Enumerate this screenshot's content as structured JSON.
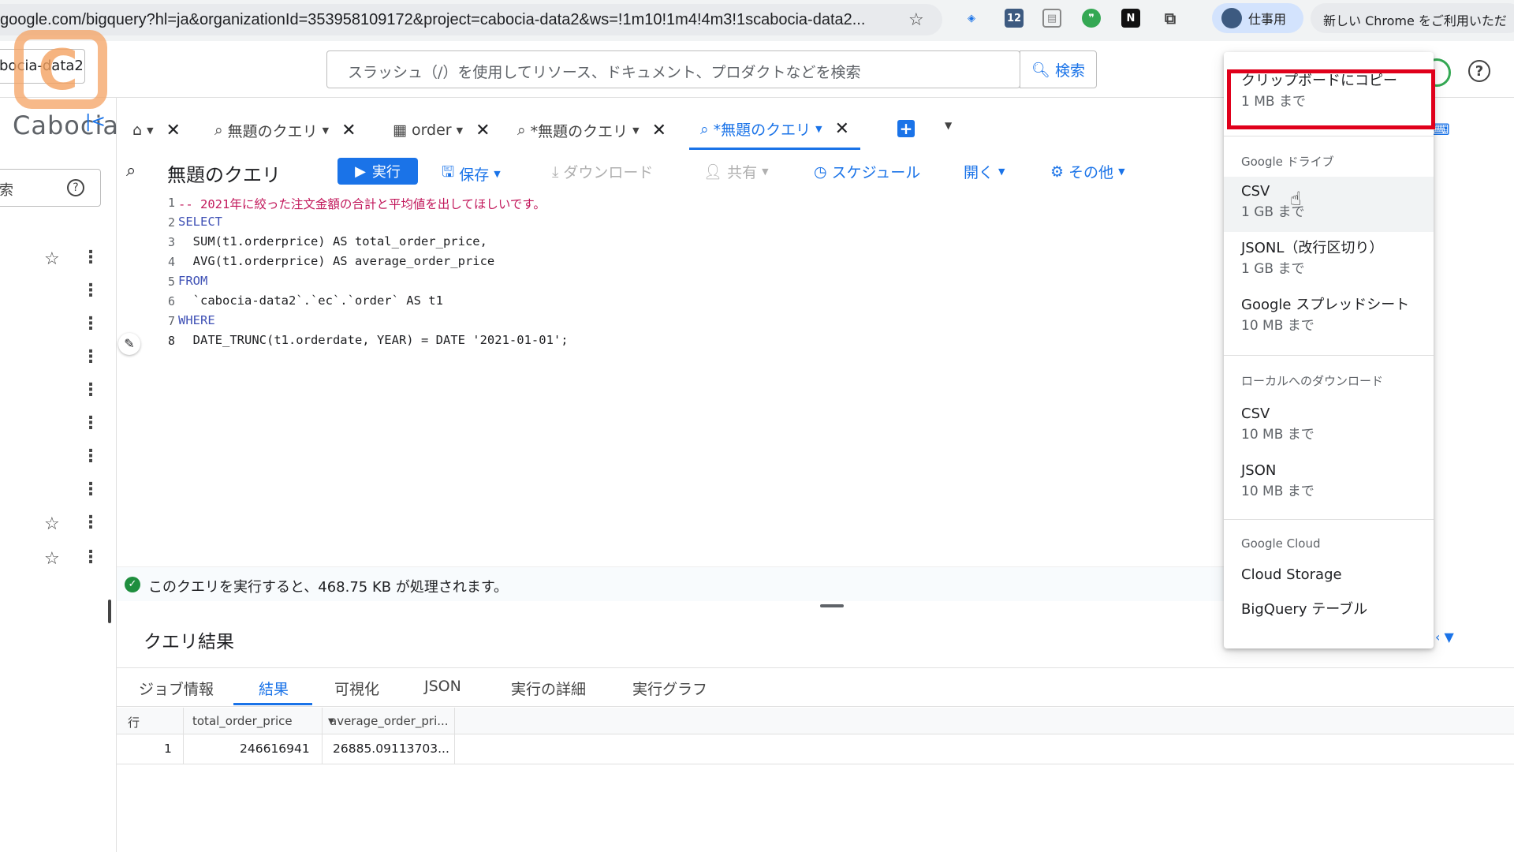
{
  "browser": {
    "url": "google.com/bigquery?hl=ja&organizationId=353958109172&project=cabocia-data2&ws=!1m10!1m4!4m3!1scabocia-data2...",
    "profile_label": "仕事用",
    "chrome_notice": "新しい Chrome をご利用いただ",
    "extension_badge": "12",
    "extension_n": "N"
  },
  "header": {
    "project_name": "bocia-data2",
    "search_placeholder": "スラッシュ（/）を使用してリソース、ドキュメント、プロダクトなどを検索",
    "search_button": "検索",
    "help_glyph": "?"
  },
  "brand": {
    "name": "Cabocia",
    "logo_letter": "C"
  },
  "sidebar": {
    "search_label": "索",
    "help_glyph": "?"
  },
  "tabs": [
    {
      "label": "無題のクエリ"
    },
    {
      "label": "order"
    },
    {
      "label": "*無題のクエリ"
    },
    {
      "label": "*無題のクエリ"
    }
  ],
  "toolbar": {
    "title": "無題のクエリ",
    "run": "実行",
    "save": "保存",
    "download": "ダウンロード",
    "share": "共有",
    "schedule": "スケジュール",
    "open": "開く",
    "more": "その他"
  },
  "editor": {
    "line_numbers": [
      "1",
      "2",
      "3",
      "4",
      "5",
      "6",
      "7",
      "8"
    ],
    "lines": [
      "-- 2021年に絞った注文金額の合計と平均値を出してほしいです。",
      "SELECT",
      "  SUM(t1.orderprice) AS total_order_price,",
      "  AVG(t1.orderprice) AS average_order_price",
      "FROM",
      "  `cabocia-data2`.`ec`.`order` AS t1",
      "WHERE",
      "  DATE_TRUNC(t1.orderdate, YEAR) = DATE '2021-01-01';"
    ]
  },
  "validator": {
    "message": "このクエリを実行すると、468.75 KB が処理されます。"
  },
  "results": {
    "title": "クエリ結果",
    "tabs": [
      "ジョブ情報",
      "結果",
      "可視化",
      "JSON",
      "実行の詳細",
      "実行グラフ"
    ],
    "active_tab": "結果",
    "columns": [
      "行",
      "total_order_price",
      "average_order_pri..."
    ],
    "rows": [
      {
        "row": "1",
        "total_order_price": "246616941",
        "average_order_price": "26885.09113703..."
      }
    ]
  },
  "menu": {
    "clipboard": {
      "label": "クリップボードにコピー",
      "sub": "1 MB まで"
    },
    "section_drive": "Google ドライブ",
    "drive_csv": {
      "label": "CSV",
      "sub": "1 GB まで"
    },
    "drive_jsonl": {
      "label": "JSONL（改行区切り）",
      "sub": "1 GB まで"
    },
    "drive_sheets": {
      "label": "Google スプレッドシート",
      "sub": "10 MB まで"
    },
    "section_local": "ローカルへのダウンロード",
    "local_csv": {
      "label": "CSV",
      "sub": "10 MB まで"
    },
    "local_json": {
      "label": "JSON",
      "sub": "10 MB まで"
    },
    "section_cloud": "Google Cloud",
    "cloud_storage": {
      "label": "Cloud Storage"
    },
    "bq_table": {
      "label": "BigQuery テーブル"
    }
  },
  "colors": {
    "accent": "#1a73e8",
    "highlight": "#e0001b",
    "success": "#1e8e3e",
    "logo": "#f4a261"
  }
}
